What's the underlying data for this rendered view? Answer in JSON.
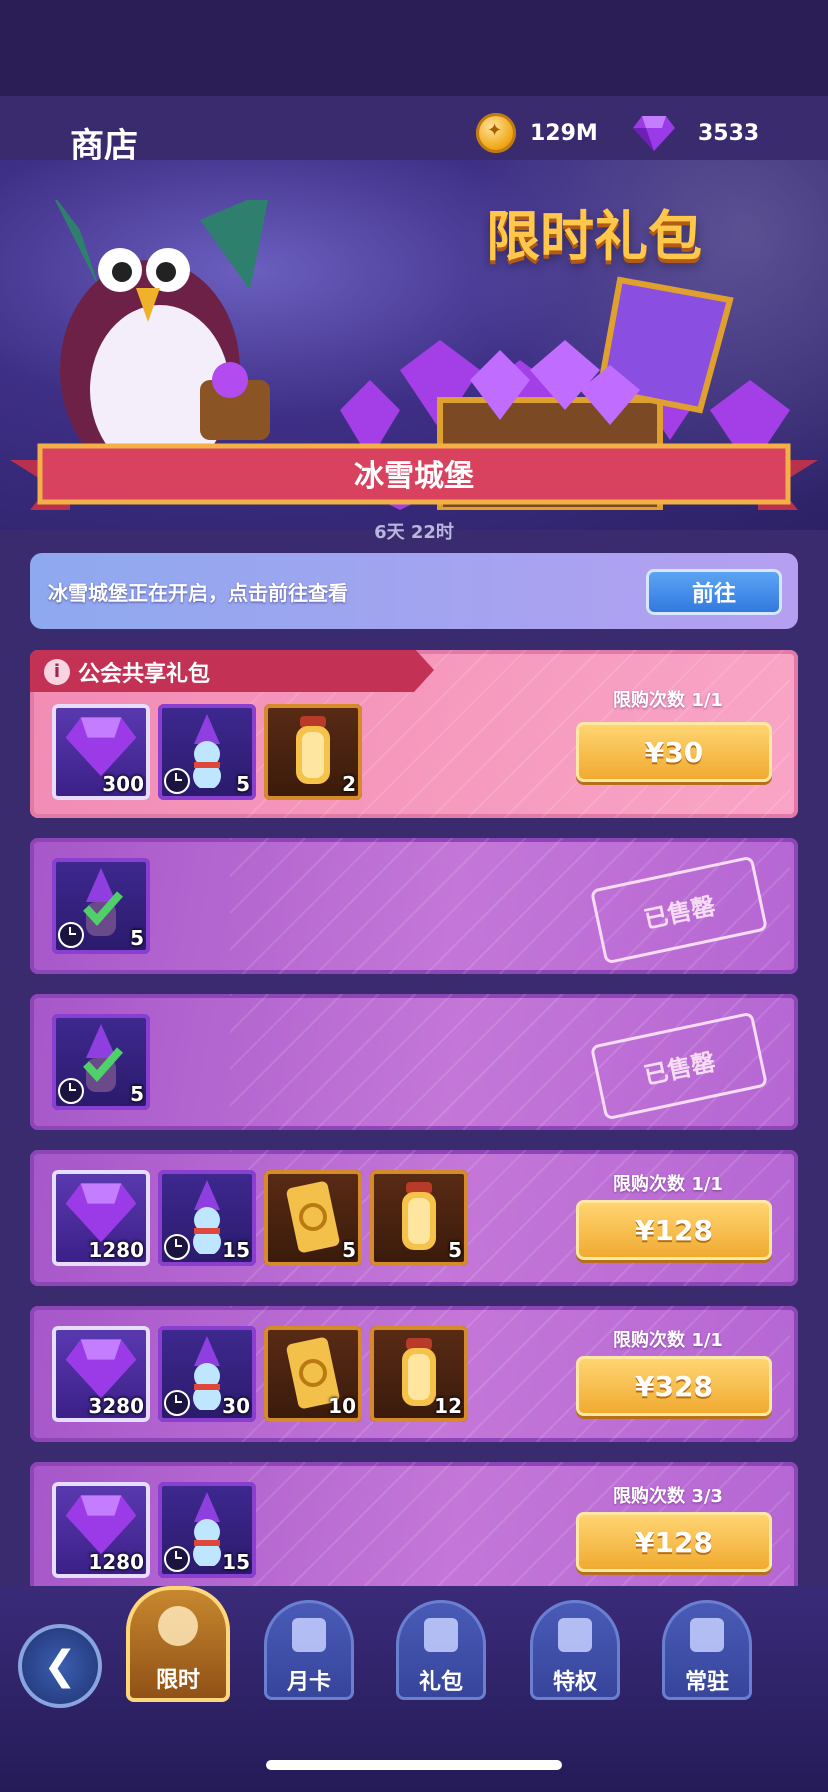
{
  "header": {
    "title": "商店",
    "coins": "129M",
    "gems": "3533"
  },
  "banner": {
    "title": "限时礼包",
    "event_name": "冰雪城堡",
    "timer": "6天 22时"
  },
  "notice": {
    "text": "冰雪城堡正在开启，点击前往查看",
    "button_label": "前往"
  },
  "offers": [
    {
      "tag": "公会共享礼包",
      "items": [
        {
          "icon": "gem-icon",
          "qty": "300"
        },
        {
          "icon": "snowman-potion-icon",
          "qty": "5",
          "timed": true
        },
        {
          "icon": "lantern-icon",
          "qty": "2"
        }
      ],
      "limit": "限购次数 1/1",
      "price": "¥30",
      "sold_out": false
    },
    {
      "items": [
        {
          "icon": "checked-potion-icon",
          "qty": "5",
          "timed": true
        }
      ],
      "sold_label": "已售罄",
      "sold_out": true
    },
    {
      "items": [
        {
          "icon": "checked-potion-icon",
          "qty": "5",
          "timed": true
        }
      ],
      "sold_label": "已售罄",
      "sold_out": true
    },
    {
      "items": [
        {
          "icon": "gem-icon",
          "qty": "1280"
        },
        {
          "icon": "snowman-potion-icon",
          "qty": "15",
          "timed": true
        },
        {
          "icon": "ticket-icon",
          "qty": "5"
        },
        {
          "icon": "lantern-icon",
          "qty": "5"
        }
      ],
      "limit": "限购次数 1/1",
      "price": "¥128",
      "sold_out": false
    },
    {
      "items": [
        {
          "icon": "gem-icon",
          "qty": "3280"
        },
        {
          "icon": "snowman-potion-icon",
          "qty": "30",
          "timed": true
        },
        {
          "icon": "ticket-icon",
          "qty": "10"
        },
        {
          "icon": "lantern-icon",
          "qty": "12"
        }
      ],
      "limit": "限购次数 1/1",
      "price": "¥328",
      "sold_out": false
    },
    {
      "items": [
        {
          "icon": "gem-icon",
          "qty": "1280"
        },
        {
          "icon": "snowman-potion-icon",
          "qty": "15",
          "timed": true
        }
      ],
      "limit": "限购次数 3/3",
      "price": "¥128",
      "sold_out": false
    }
  ],
  "nav": {
    "tabs": [
      {
        "label": "限时",
        "icon": "gift-hat-icon",
        "active": true
      },
      {
        "label": "月卡",
        "icon": "card-icon"
      },
      {
        "label": "礼包",
        "icon": "party-popper-icon"
      },
      {
        "label": "特权",
        "icon": "vip-icon"
      },
      {
        "label": "常驻",
        "icon": "gift-box-icon"
      }
    ]
  },
  "colors": {
    "accent_gold": "#ffc84a",
    "price_button": "#f0a82d",
    "row_purple": "#b566d3",
    "row_pink": "#f28cb4"
  }
}
